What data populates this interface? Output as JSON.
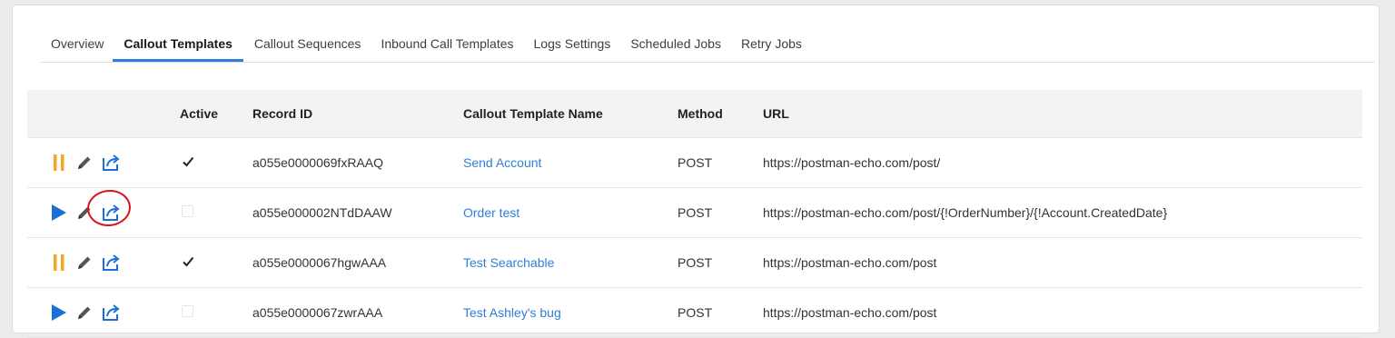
{
  "tabs": [
    {
      "label": "Overview",
      "active": false
    },
    {
      "label": "Callout Templates",
      "active": true
    },
    {
      "label": "Callout Sequences",
      "active": false
    },
    {
      "label": "Inbound Call Templates",
      "active": false
    },
    {
      "label": "Logs Settings",
      "active": false
    },
    {
      "label": "Scheduled Jobs",
      "active": false
    },
    {
      "label": "Retry Jobs",
      "active": false
    }
  ],
  "table": {
    "headers": {
      "active": "Active",
      "record_id": "Record ID",
      "name": "Callout Template Name",
      "method": "Method",
      "url": "URL"
    },
    "rows": [
      {
        "state": "paused",
        "state_icon": "pause-icon",
        "active": true,
        "record_id": "a055e0000069fxRAAQ",
        "name": "Send Account",
        "method": "POST",
        "url": "https://postman-echo.com/post/"
      },
      {
        "state": "stopped",
        "state_icon": "play-icon",
        "active": false,
        "record_id": "a055e000002NTdDAAW",
        "name": "Order test",
        "method": "POST",
        "url": "https://postman-echo.com/post/{!OrderNumber}/{!Account.CreatedDate}",
        "highlight_export": true
      },
      {
        "state": "paused",
        "state_icon": "pause-icon",
        "active": true,
        "record_id": "a055e0000067hgwAAA",
        "name": "Test Searchable",
        "method": "POST",
        "url": "https://postman-echo.com/post"
      },
      {
        "state": "stopped",
        "state_icon": "play-icon",
        "active": false,
        "record_id": "a055e0000067zwrAAA",
        "name": "Test Ashley's bug",
        "method": "POST",
        "url": "https://postman-echo.com/post"
      }
    ]
  },
  "colors": {
    "accent": "#2f7fd8",
    "pause": "#f5a623",
    "play": "#1a6fd6",
    "annotation": "#d8141d"
  }
}
